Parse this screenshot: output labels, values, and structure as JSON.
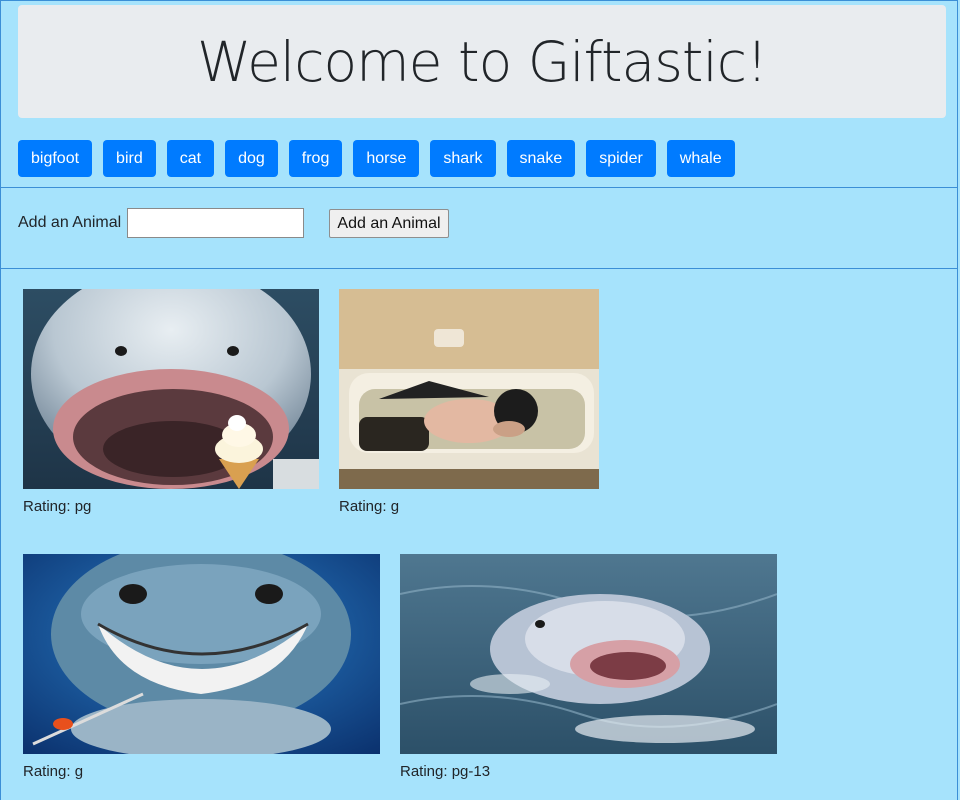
{
  "header": {
    "title": "Welcome to Giftastic!"
  },
  "animal_buttons": [
    "bigfoot",
    "bird",
    "cat",
    "dog",
    "frog",
    "horse",
    "shark",
    "snake",
    "spider",
    "whale"
  ],
  "form": {
    "label": "Add an Animal",
    "input_value": "",
    "submit_label": "Add an Animal"
  },
  "gifs": [
    {
      "rating": "Rating: pg",
      "subject": "shark-with-ice-cream"
    },
    {
      "rating": "Rating: g",
      "subject": "child-with-shark-fin-in-bathtub"
    },
    {
      "rating": "Rating: g",
      "subject": "smiling-cartoon-shark"
    },
    {
      "rating": "Rating: pg-13",
      "subject": "shark-in-water"
    }
  ]
}
